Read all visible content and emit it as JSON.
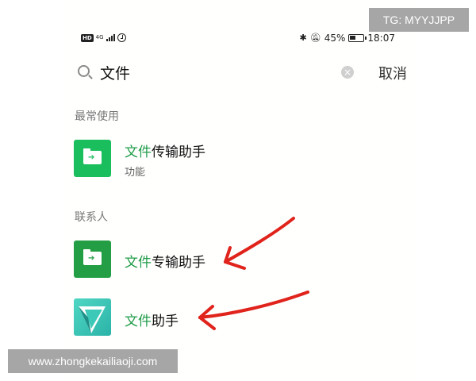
{
  "status_bar": {
    "hd": "HD",
    "network": "4G",
    "battery_percent": "45%",
    "time": "18:07"
  },
  "search": {
    "query": "文件",
    "cancel_label": "取消"
  },
  "sections": {
    "frequent": {
      "label": "最常使用",
      "items": [
        {
          "title_highlight": "文件",
          "title_rest": "传输助手",
          "subtitle": "功能",
          "icon": "folder-transfer-icon"
        }
      ]
    },
    "contacts": {
      "label": "联系人",
      "items": [
        {
          "title_highlight": "文件",
          "title_rest": "专输助手",
          "icon": "folder-transfer-icon"
        },
        {
          "title_highlight": "文件",
          "title_rest": "助手",
          "icon": "paper-plane-icon"
        }
      ]
    }
  },
  "colors": {
    "highlight": "#1f9c48",
    "icon_green": "#1bbe5c",
    "icon_dark_green": "#239e45",
    "annotation_red": "#e0231b"
  },
  "watermarks": {
    "tg": "TG: MYYJJPP",
    "site": "www.zhongkekailiaoji.com"
  }
}
